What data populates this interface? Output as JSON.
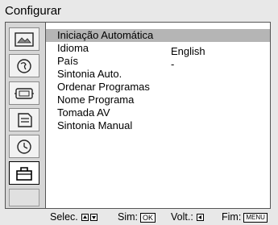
{
  "header": {
    "title": "Configurar"
  },
  "sidebar": {
    "icons": [
      {
        "name": "picture-icon"
      },
      {
        "name": "sound-icon"
      },
      {
        "name": "screen-control-icon"
      },
      {
        "name": "features-icon"
      },
      {
        "name": "timer-icon"
      },
      {
        "name": "setup-toolbox-icon",
        "selected": true
      },
      {
        "name": "empty-slot"
      }
    ]
  },
  "menu": {
    "items": [
      {
        "label": "Iniciação Automática",
        "value": "",
        "highlighted": true
      },
      {
        "label": "Idioma",
        "value": "English"
      },
      {
        "label": "País",
        "value": "-"
      },
      {
        "label": "Sintonia Auto.",
        "value": ""
      },
      {
        "label": "Ordenar Programas",
        "value": ""
      },
      {
        "label": "Nome Programa",
        "value": ""
      },
      {
        "label": "Tomada AV",
        "value": ""
      },
      {
        "label": "Sintonia Manual",
        "value": ""
      }
    ]
  },
  "footer": {
    "select_label": "Selec.",
    "confirm_label": "Sim:",
    "confirm_key": "OK",
    "back_label": "Volt.:",
    "exit_label": "Fim:",
    "exit_key": "MENU"
  }
}
